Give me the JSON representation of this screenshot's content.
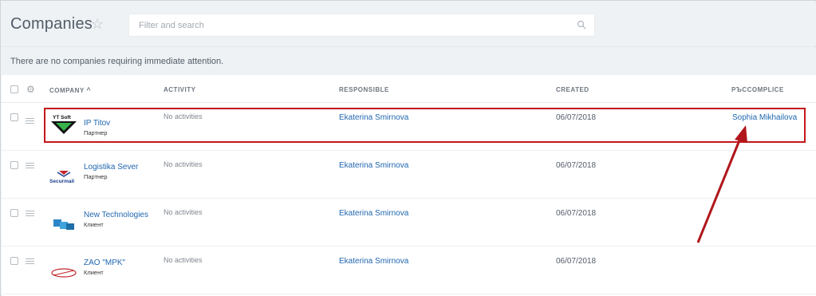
{
  "header": {
    "title": "Companies",
    "search_placeholder": "Filter and search"
  },
  "notice": "There are no companies requiring immediate attention.",
  "columns": {
    "company": "COMPANY",
    "activity": "ACTIVITY",
    "responsible": "RESPONSIBLE",
    "created": "CREATED",
    "extra": "РЪССOMPLICE"
  },
  "rows": [
    {
      "logo": "ytsoft-logo",
      "logo_text": "YT Soft",
      "name": "IP Titov",
      "type": "Партнер",
      "activity": "No activities",
      "responsible": "Ekaterina Smirnova",
      "created": "06/07/2018",
      "extra": "Sophia Mikhailova"
    },
    {
      "logo": "securmail-logo",
      "logo_text": "Securmail",
      "name": "Logistika Sever",
      "type": "Партнер",
      "activity": "No activities",
      "responsible": "Ekaterina Smirnova",
      "created": "06/07/2018",
      "extra": ""
    },
    {
      "logo": "cubes-logo",
      "name": "New Technologies",
      "type": "Клиент",
      "activity": "No activities",
      "responsible": "Ekaterina Smirnova",
      "created": "06/07/2018",
      "extra": ""
    },
    {
      "logo": "mpk-logo",
      "name": "ZAO \"MPK\"",
      "type": "Клиент",
      "activity": "No activities",
      "responsible": "Ekaterina Smirnova",
      "created": "06/07/2018",
      "extra": ""
    }
  ],
  "colors": {
    "link": "#2067b0",
    "highlight": "#c4171c",
    "background": "#eef2f4"
  }
}
